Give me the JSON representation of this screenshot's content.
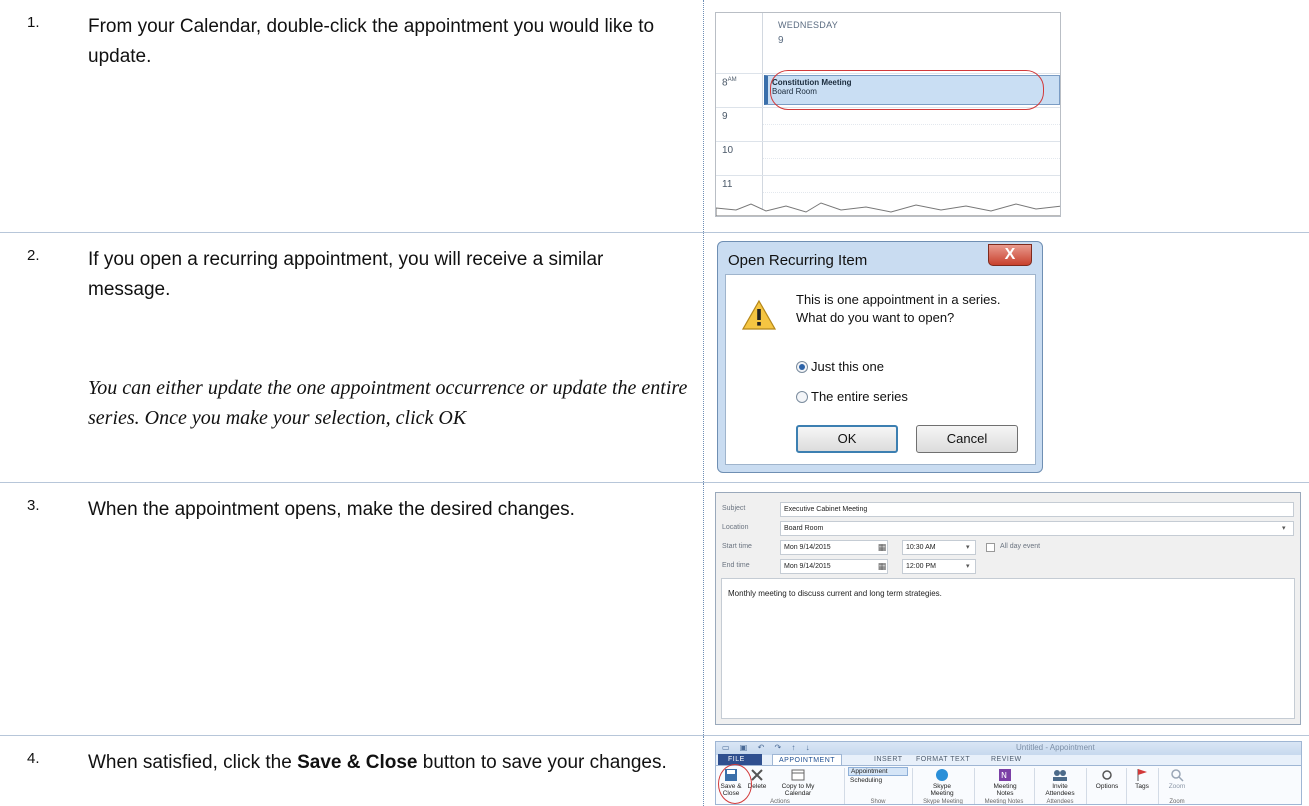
{
  "steps": [
    {
      "number": "1.",
      "text": "From your Calendar, double-click the appointment you would like to update."
    },
    {
      "number": "2.",
      "text": "If you open a recurring appointment, you will receive a similar message.",
      "note": "You can either update the one appointment occurrence or update the entire series.  Once you make your selection, click OK"
    },
    {
      "number": "3.",
      "text": "When the appointment opens, make the desired changes."
    },
    {
      "number": "4.",
      "text_before": "When satisfied, click the ",
      "text_bold": "Save & Close",
      "text_after": " button to save your changes."
    }
  ],
  "calendar": {
    "day_name": "WEDNESDAY",
    "day_number": "9",
    "hours": [
      "8",
      "9",
      "10",
      "11"
    ],
    "hour_suffix": "AM",
    "appointment_title": "Constitution Meeting",
    "appointment_location": "Board Room"
  },
  "dialog": {
    "title": "Open Recurring Item",
    "close": "X",
    "message_line1": "This is one appointment in a series.",
    "message_line2": "What do you want to open?",
    "option_one": "Just this one",
    "option_two": "The entire series",
    "ok": "OK",
    "cancel": "Cancel"
  },
  "appointment_form": {
    "subject_label": "Subject",
    "subject_value": "Executive Cabinet Meeting",
    "location_label": "Location",
    "location_value": "Board Room",
    "start_label": "Start time",
    "start_date": "Mon 9/14/2015",
    "start_time": "10:30 AM",
    "all_day": "All day event",
    "end_label": "End time",
    "end_date": "Mon 9/14/2015",
    "end_time": "12:00 PM",
    "notes": "Monthly meeting to discuss current and long term strategies."
  },
  "ribbon": {
    "window_title": "Untitled - Appointment",
    "tabs": [
      "FILE",
      "APPOINTMENT",
      "INSERT",
      "FORMAT TEXT",
      "REVIEW"
    ],
    "save_close_1": "Save &",
    "save_close_2": "Close",
    "delete": "Delete",
    "copy_1": "Copy to My",
    "copy_2": "Calendar",
    "appointment": "Appointment",
    "scheduling": "Scheduling",
    "skype_1": "Skype",
    "skype_2": "Meeting",
    "notes_1": "Meeting",
    "notes_2": "Notes",
    "invite_1": "Invite",
    "invite_2": "Attendees",
    "options": "Options",
    "tags": "Tags",
    "zoom": "Zoom",
    "groups": [
      "Actions",
      "Show",
      "Skype Meeting",
      "Meeting Notes",
      "Attendees",
      "Zoom"
    ]
  },
  "colors": {
    "accent_red": "#d23a3a",
    "appointment_blue": "#c9def3",
    "dialog_frame": "#c9dcf1",
    "file_tab": "#2f4f8f"
  }
}
